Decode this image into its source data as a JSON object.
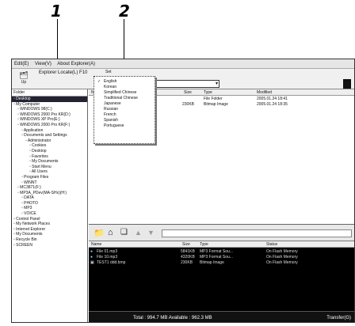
{
  "callouts": {
    "one": "1",
    "two": "2"
  },
  "menubar": {
    "items": [
      "Edit(E)",
      "View(V)",
      "About Explorer(A)"
    ]
  },
  "toolbar": {
    "title": "Explorer Locate(L)  F10",
    "up_label": "Up",
    "set_label": "Set"
  },
  "folder_pane": {
    "header": "Folder",
    "items": [
      "Desktop",
      "My Computer",
      "WINDOWS 98(C:)",
      "WINDOWS 2000 Pro KR(D:)",
      "WINDOWS XP Pro(E:)",
      "WINDOWS 2000 Pro KR(F:)",
      "Application",
      "Documents and Settings",
      "Administrator",
      "Cookies",
      "Desktop",
      "Favorites",
      "My Documents",
      "Start Menu",
      "All Users",
      "Program Files",
      "WINNT",
      "MC3871(F:)",
      "MP3A_PDev(MA-SHx)(H:)",
      "DATA",
      "PHOTO",
      "MP3",
      "VOICE",
      "Control Panel",
      "My Network Places",
      "Internet Explorer",
      "My Documents",
      "Recycle Bin",
      "SCREEN"
    ]
  },
  "top_list": {
    "columns": [
      "Name",
      "Size",
      "Type",
      "Modified"
    ],
    "rows": [
      {
        "name": "",
        "size": "",
        "type": "File Folder",
        "modified": "2005.01.24 18:41"
      },
      {
        "name": "",
        "size": "230KB",
        "type": "Bitmap Image",
        "modified": "2005.01.24 18:35"
      }
    ]
  },
  "language_menu": {
    "items": [
      "English",
      "Korean",
      "Simplified Chinese",
      "Traditional Chinese",
      "Japanese",
      "Russian",
      "French",
      "Spanish",
      "Portuguese"
    ],
    "selected": "English"
  },
  "device_list": {
    "columns": [
      "Name",
      "Size",
      "Type",
      "Status"
    ],
    "rows": [
      {
        "name": "File 01.mp3",
        "size": "5841KB",
        "type": "MP3 Format Sou...",
        "status": "On Flash Memory"
      },
      {
        "name": "File 10.mp3",
        "size": "4320KB",
        "type": "MP3 Format Sou...",
        "status": "On Flash Memory"
      },
      {
        "name": "TEST1 ddd.bmp",
        "size": "230KB",
        "type": "Bitmap Image",
        "status": "On Flash Memory"
      }
    ]
  },
  "status_bar": {
    "text": "Total : 994.7 MB   Available : 962.3 MB",
    "transfer": "Transfer(G)"
  }
}
